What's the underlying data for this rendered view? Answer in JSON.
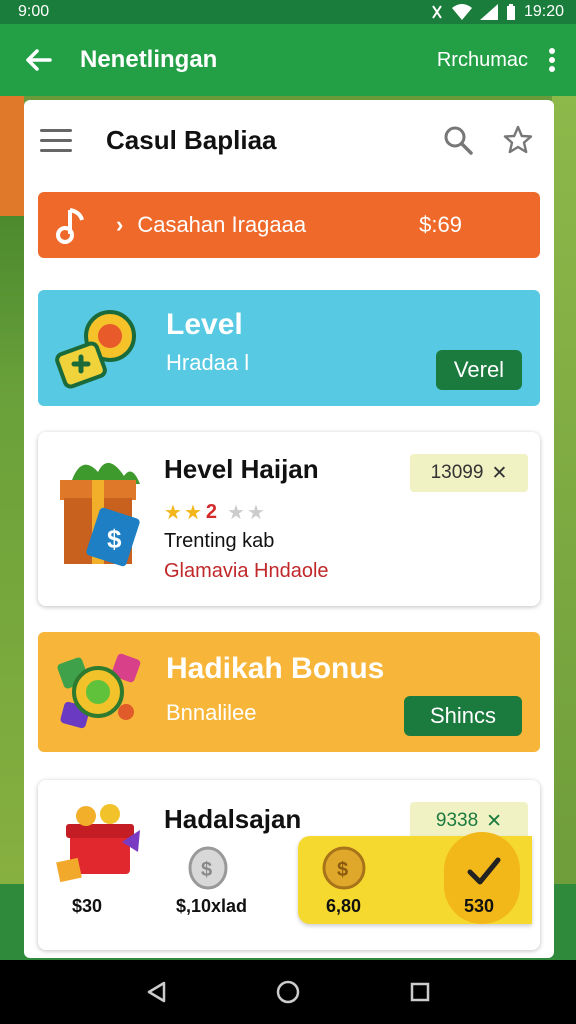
{
  "status_bar": {
    "time": "9:00",
    "clock": "19:20"
  },
  "app_bar": {
    "title": "Nenetlingan",
    "action": "Rrchumac"
  },
  "header": {
    "title": "Casul Bapliaa"
  },
  "promo": {
    "text": "Casahan Iragaaa",
    "price": "$:69"
  },
  "level_card": {
    "title": "Level",
    "subtitle": "Hradaa l",
    "button": "Verel"
  },
  "item1": {
    "title": "Hevel Haijan",
    "tag": "13099",
    "rating_value": "2",
    "line1": "Trenting kab",
    "line2": "Glamavia Hndaole"
  },
  "bonus_card": {
    "title": "Hadikah Bonus",
    "subtitle": "Bnnalilee",
    "button": "Shincs"
  },
  "item2": {
    "title": "Hadalsajan",
    "tag": "9338",
    "rewards": [
      "$30",
      "$,10xlad",
      "6,80",
      "530"
    ]
  },
  "colors": {
    "primary_green": "#23a046",
    "dark_green": "#1b7a3e",
    "promo_orange": "#ef6a2a",
    "level_blue": "#58c9e2",
    "bonus_orange": "#f7b63a",
    "claim_yellow": "#f6d92e"
  }
}
